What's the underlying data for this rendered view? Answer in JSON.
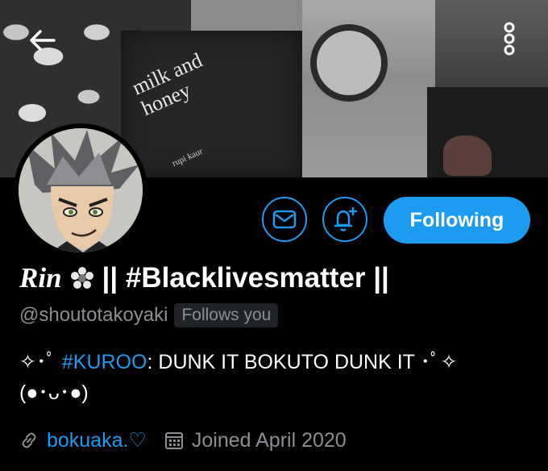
{
  "banner": {
    "book_title": "milk and\nhoney",
    "book_author": "rupi kaur"
  },
  "actions": {
    "following_label": "Following"
  },
  "profile": {
    "name_prefix": "Rin",
    "name_suffix": "|| #Blacklivesmatter ||",
    "handle": "@shoutotakoyaki",
    "follows_you": "Follows you",
    "bio_line1_prefix": "✧･ﾟ ",
    "bio_hashtag": "#KUROO",
    "bio_line1_suffix": ": DUNK IT BOKUTO DUNK IT ･ﾟ✧",
    "bio_line2": "(●･ᴗ･●)",
    "website": "bokuaka.♡",
    "joined": "Joined April 2020"
  },
  "colors": {
    "accent": "#1d9bf0",
    "background": "#000000",
    "secondary_text": "#8b8f93"
  },
  "icons": [
    "back-arrow-icon",
    "more-vertical-icon",
    "mail-icon",
    "bell-plus-icon",
    "flower-icon",
    "link-icon",
    "calendar-icon"
  ]
}
